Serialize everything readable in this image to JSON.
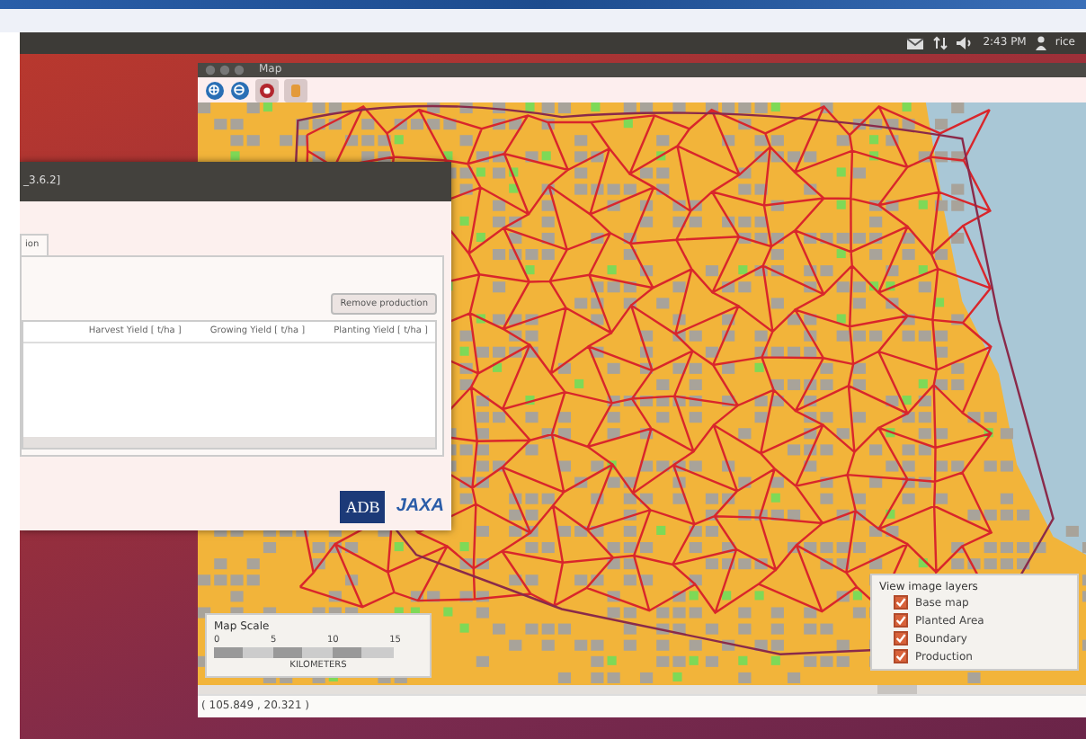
{
  "panel": {
    "clock": "2:43 PM",
    "user": "rice"
  },
  "map_window": {
    "title": "Map",
    "map_scale": {
      "title": "Map Scale",
      "ticks": [
        "0",
        "5",
        "10",
        "15"
      ],
      "unit": "KILOMETERS"
    },
    "layers": {
      "title": "View image layers",
      "items": [
        {
          "label": "Base map",
          "checked": true
        },
        {
          "label": "Planted Area",
          "checked": true
        },
        {
          "label": "Boundary",
          "checked": true
        },
        {
          "label": "Production",
          "checked": true
        }
      ]
    },
    "status_bar": "( 105.849 , 20.321 )"
  },
  "yield_window": {
    "title": "_3.6.2]",
    "tabs": [
      {
        "label": "ion",
        "selected": true
      }
    ],
    "remove_button": "Remove production",
    "columns": [
      "Harvest Yield [ t/ha ]",
      "Growing Yield [ t/ha ]",
      "Planting Yield [ t/ha ]"
    ],
    "logos": [
      "ADB",
      "JAXA"
    ]
  }
}
